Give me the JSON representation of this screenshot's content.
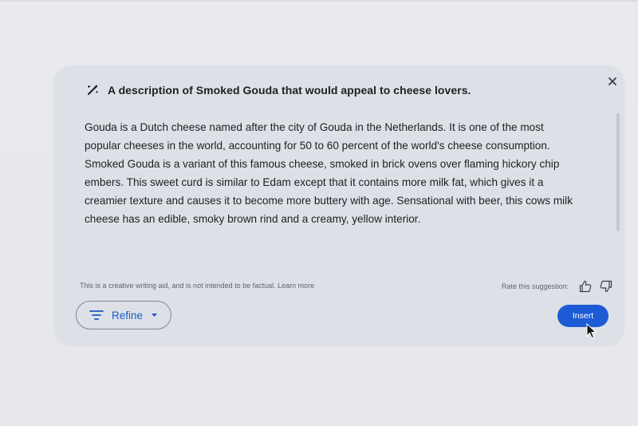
{
  "prompt": {
    "icon": "magic-pen-icon",
    "text": "A description of Smoked Gouda that would appeal to cheese lovers."
  },
  "close": {
    "icon": "close-icon",
    "label": "×"
  },
  "suggestion": {
    "lines": [
      "Gouda is a Dutch cheese named after the city of Gouda in the Netherlands. It is one of the most",
      "popular cheeses in the world, accounting for 50 to 60 percent of the world's cheese consumption.",
      "Smoked Gouda is a variant of this famous cheese, smoked in brick ovens over flaming hickory chip",
      "embers. This sweet curd is similar to Edam except that it contains more milk fat, which gives it a",
      "creamier texture and causes it to become more buttery with age. Sensational with beer, this cows milk",
      "cheese has an edible, smoky brown rind and a creamy, yellow interior."
    ]
  },
  "footer": {
    "disclaimer": "This is a creative writing aid, and is not intended to be factual.",
    "learn_more": "Learn more",
    "rate_label": "Rate this suggestion:",
    "thumbs_up_icon": "thumbs-up-icon",
    "thumbs_down_icon": "thumbs-down-icon"
  },
  "actions": {
    "refine_label": "Refine",
    "refine_icon": "filter-lines-icon",
    "refine_caret_icon": "caret-down-icon",
    "insert_label": "Insert"
  },
  "colors": {
    "panel_bg": "#dde1e7",
    "page_bg": "#e8eaed",
    "accent_blue": "#1d5bd6",
    "refine_text": "#1a57c9"
  }
}
